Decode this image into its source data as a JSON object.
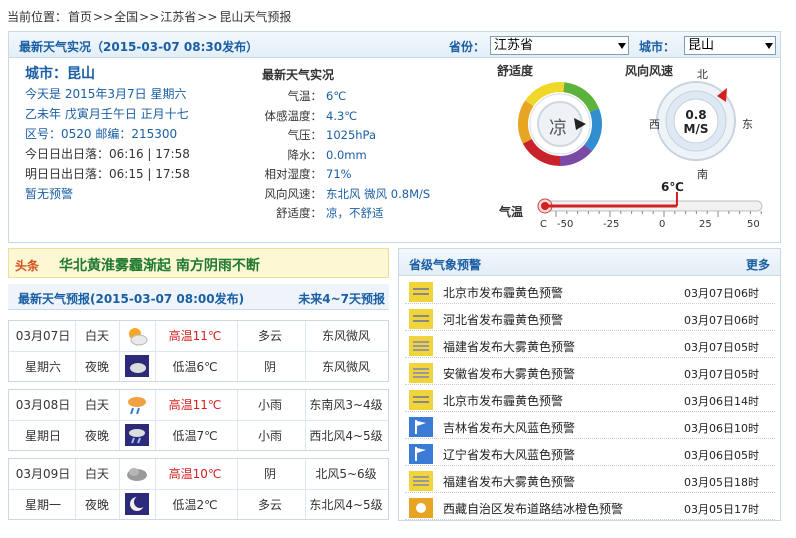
{
  "breadcrumb": {
    "prefix": "当前位置：",
    "items": [
      "首页",
      ">>",
      "全国",
      ">>",
      "江苏省",
      ">>",
      "昆山天气预报"
    ]
  },
  "current": {
    "title": "最新天气实况（2015-03-07 08:30发布）",
    "province_label": "省份：",
    "province_value": "江苏省",
    "city_label": "城市：",
    "city_value": "昆山",
    "city_title": "城市：昆山",
    "today": "今天是 2015年3月7日 星期六",
    "lunar": "乙未年 戊寅月壬午日 正月十七",
    "area_code": "区号：0520  邮编：215300",
    "sun_today": "今日日出日落：06:16 | 17:58",
    "sun_tomorrow": "明日日出日落：06:15 | 17:58",
    "alert": "暂无预警",
    "obs_title": "最新天气实况",
    "obs": [
      {
        "k": "气温：",
        "v": "6℃"
      },
      {
        "k": "体感温度：",
        "v": "4.3℃"
      },
      {
        "k": "气压：",
        "v": "1025hPa"
      },
      {
        "k": "降水：",
        "v": "0.0mm"
      },
      {
        "k": "相对湿度：",
        "v": "71%"
      },
      {
        "k": "风向风速：",
        "v": "东北风 微风 0.8M/S"
      },
      {
        "k": "舒适度：",
        "v": "凉，不舒适"
      }
    ],
    "comfort_label": "舒适度",
    "comfort_value": "凉",
    "wind_label": "风向风速",
    "wind_speed": "0.8",
    "wind_unit": "M/S",
    "dirs": {
      "n": "北",
      "s": "南",
      "e": "东",
      "w": "西"
    },
    "temp_label": "气温",
    "temp_value": "6℃",
    "temp_numeric": 6,
    "thermo_ticks": [
      "C",
      "-50",
      "-25",
      "0",
      "25",
      "50"
    ]
  },
  "headline": {
    "tag": "头条",
    "text": "华北黄淮雾霾渐起  南方阴雨不断"
  },
  "forecast": {
    "title": "最新天气预报(2015-03-07 08:00发布)",
    "more": "未来4~7天预报",
    "days": [
      {
        "date": "03月07日",
        "week": "星期六",
        "day_label": "白天",
        "night_label": "夜晚",
        "day_icon": "sun-cloud-icon",
        "night_icon": "cloud-night-icon",
        "high": "高温11℃",
        "low": "低温6℃",
        "day_wx": "多云",
        "night_wx": "阴",
        "day_wind": "东风微风",
        "night_wind": "东风微风"
      },
      {
        "date": "03月08日",
        "week": "星期日",
        "day_label": "白天",
        "night_label": "夜晚",
        "day_icon": "rain-icon",
        "night_icon": "rain-night-icon",
        "high": "高温11℃",
        "low": "低温7℃",
        "day_wx": "小雨",
        "night_wx": "小雨",
        "day_wind": "东南风3~4级",
        "night_wind": "西北风4~5级"
      },
      {
        "date": "03月09日",
        "week": "星期一",
        "day_label": "白天",
        "night_label": "夜晚",
        "day_icon": "overcast-icon",
        "night_icon": "moon-icon",
        "high": "高温10℃",
        "low": "低温2℃",
        "day_wx": "阴",
        "night_wx": "多云",
        "day_wind": "北风5~6级",
        "night_wind": "东北风4~5级"
      }
    ]
  },
  "warnings": {
    "title": "省级气象预警",
    "more": "更多",
    "items": [
      {
        "text": "北京市发布霾黄色预警",
        "time": "03月07日06时",
        "icon": "haze"
      },
      {
        "text": "河北省发布霾黄色预警",
        "time": "03月07日06时",
        "icon": "haze"
      },
      {
        "text": "福建省发布大雾黄色预警",
        "time": "03月07日05时",
        "icon": "fog"
      },
      {
        "text": "安徽省发布大雾黄色预警",
        "time": "03月07日05时",
        "icon": "fog"
      },
      {
        "text": "北京市发布霾黄色预警",
        "time": "03月06日14时",
        "icon": "haze"
      },
      {
        "text": "吉林省发布大风蓝色预警",
        "time": "03月06日10时",
        "icon": "wind"
      },
      {
        "text": "辽宁省发布大风蓝色预警",
        "time": "03月06日05时",
        "icon": "wind"
      },
      {
        "text": "福建省发布大雾黄色预警",
        "time": "03月05日18时",
        "icon": "fog"
      },
      {
        "text": "西藏自治区发布道路结冰橙色预警",
        "time": "03月05日17时",
        "icon": "ice"
      }
    ]
  }
}
